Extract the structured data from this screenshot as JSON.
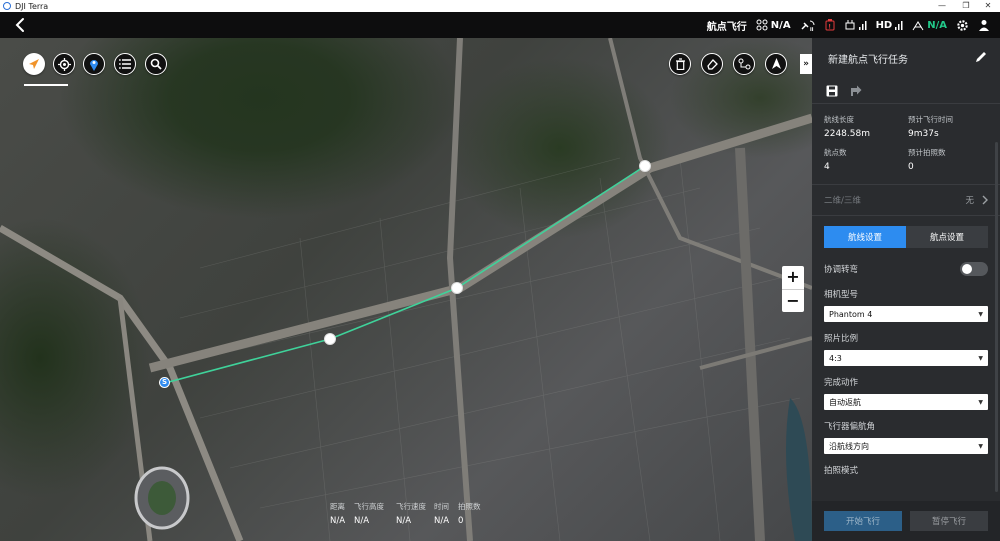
{
  "window": {
    "title": "DJI Terra",
    "controls": [
      "—",
      "❐",
      "✕"
    ]
  },
  "header": {
    "mode_label": "航点飞行",
    "signal1_value": "N/A",
    "hd_label": "HD",
    "battery_value": "N/A",
    "colors": {
      "accent_green": "#22c98a",
      "warning_red": "#e23c3c"
    }
  },
  "map": {
    "top_left_buttons": [
      "compass-icon",
      "locate-icon",
      "pin-icon",
      "list-icon",
      "search-icon"
    ],
    "top_right_buttons": [
      "trash-icon",
      "eraser-icon",
      "route-icon",
      "north-icon"
    ],
    "expand_glyph": "»",
    "zoom_in": "+",
    "zoom_out": "−",
    "start_marker": "S",
    "stats": [
      {
        "label": "距离",
        "value": "N/A"
      },
      {
        "label": "飞行高度",
        "value": "N/A"
      },
      {
        "label": "飞行速度",
        "value": "N/A"
      },
      {
        "label": "时间",
        "value": "N/A"
      },
      {
        "label": "拍照数",
        "value": "0"
      }
    ]
  },
  "panel": {
    "title": "新建航点飞行任务",
    "route_length_label": "航线长度",
    "route_length_value": "2248.58m",
    "flight_time_label": "预计飞行时间",
    "flight_time_value": "9m37s",
    "waypoints_label": "航点数",
    "waypoints_value": "4",
    "photos_label": "预计拍照数",
    "photos_value": "0",
    "dimension_label": "二维/三维",
    "dimension_value": "无",
    "tabs": [
      {
        "label": "航线设置",
        "active": true
      },
      {
        "label": "航点设置",
        "active": false
      }
    ],
    "coordinated_turn_label": "协调转弯",
    "coordinated_turn_on": false,
    "camera_model_label": "相机型号",
    "camera_model_value": "Phantom 4",
    "aspect_ratio_label": "照片比例",
    "aspect_ratio_value": "4:3",
    "finish_action_label": "完成动作",
    "finish_action_value": "自动返航",
    "heading_label": "飞行器偏航角",
    "heading_value": "沿航线方向",
    "photo_mode_label": "拍照模式",
    "start_button": "开始飞行",
    "pause_button": "暂停飞行",
    "colors": {
      "primary_blue": "#2d8cf0"
    }
  }
}
